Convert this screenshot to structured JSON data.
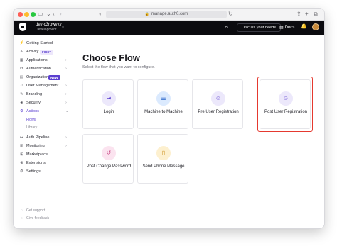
{
  "browser": {
    "url": "manage.auth0.com"
  },
  "topnav": {
    "tenant_name": "dev-c3rowvkv",
    "tenant_env": "Development",
    "discuss_label": "Discuss your needs",
    "docs_label": "Docs"
  },
  "sidebar": {
    "items": [
      {
        "label": "Getting Started",
        "icon": "rocket-icon"
      },
      {
        "label": "Activity",
        "icon": "activity-icon",
        "badge": "FIRST"
      },
      {
        "label": "Applications",
        "icon": "applications-icon"
      },
      {
        "label": "Authentication",
        "icon": "authentication-icon"
      },
      {
        "label": "Organizations",
        "icon": "organizations-icon",
        "badge": "NEW"
      },
      {
        "label": "User Management",
        "icon": "user-management-icon"
      },
      {
        "label": "Branding",
        "icon": "branding-icon"
      },
      {
        "label": "Security",
        "icon": "security-icon"
      },
      {
        "label": "Actions",
        "icon": "actions-icon"
      },
      {
        "label": "Auth Pipeline",
        "icon": "auth-pipeline-icon"
      },
      {
        "label": "Monitoring",
        "icon": "monitoring-icon"
      },
      {
        "label": "Marketplace",
        "icon": "marketplace-icon"
      },
      {
        "label": "Extensions",
        "icon": "extensions-icon"
      },
      {
        "label": "Settings",
        "icon": "settings-icon"
      }
    ],
    "actions_sub": [
      "Flows",
      "Library"
    ],
    "footer": [
      "Get support",
      "Give feedback"
    ]
  },
  "main": {
    "title": "Choose Flow",
    "subtitle": "Select the flow that you want to configure.",
    "cards": [
      {
        "label": "Login",
        "icon": "login-icon",
        "color": "#ece8fb"
      },
      {
        "label": "Machine to Machine",
        "icon": "server-icon",
        "color": "#dbeafe"
      },
      {
        "label": "Pre User Registration",
        "icon": "user-plus-icon",
        "color": "#ece8fb"
      },
      {
        "label": "Post User Registration",
        "icon": "user-plus-icon",
        "color": "#ece8fb"
      },
      {
        "label": "Post Change Password",
        "icon": "reset-icon",
        "color": "#fbe3ef"
      },
      {
        "label": "Send Phone Message",
        "icon": "phone-icon",
        "color": "#fdf0cf"
      }
    ],
    "highlight_color": "#e5392f"
  }
}
